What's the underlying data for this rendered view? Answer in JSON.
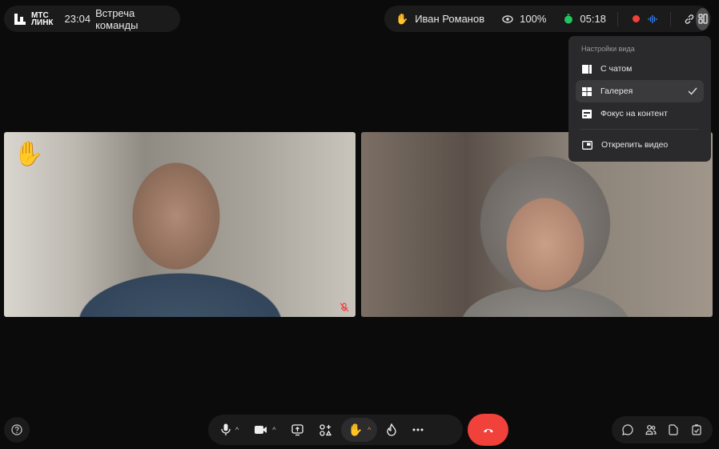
{
  "header": {
    "logo_line1": "МТС",
    "logo_line2": "ЛИНК",
    "time": "23:04",
    "meeting_title": "Встреча команды"
  },
  "status": {
    "raised_hand_user": "Иван Романов",
    "quality": "100%",
    "timer": "05:18"
  },
  "view_menu": {
    "title": "Настройки вида",
    "items": [
      {
        "label": "С чатом"
      },
      {
        "label": "Галерея",
        "selected": true
      },
      {
        "label": "Фокус на контент"
      },
      {
        "label": "Открепить видео"
      }
    ]
  },
  "colors": {
    "accent_orange": "#f28a3c",
    "record_red": "#f0413a",
    "timer_green": "#22c55e",
    "audio_blue": "#2f7df6"
  }
}
